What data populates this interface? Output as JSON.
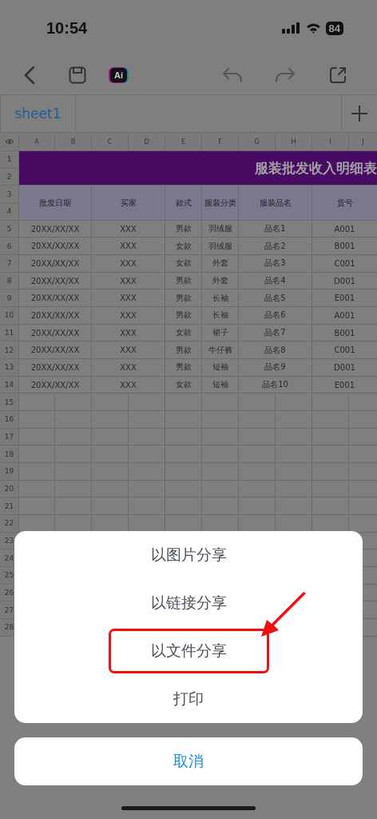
{
  "status_bar": {
    "time": "10:54",
    "battery": "84"
  },
  "toolbar": {
    "ai_label": "Ai"
  },
  "sheet_tabs": [
    {
      "label": "sheet1",
      "selected": true
    }
  ],
  "spreadsheet": {
    "column_headers": [
      "A",
      "B",
      "C",
      "D",
      "E",
      "F",
      "G",
      "H",
      "I",
      "J"
    ],
    "title_rows": [
      "1",
      "2"
    ],
    "title": "服装批发收入明细表",
    "header_rows": [
      "3",
      "4"
    ],
    "columns": [
      {
        "label": "批发日期"
      },
      {
        "label": "买家"
      },
      {
        "label": "款式"
      },
      {
        "label": "服装分类"
      },
      {
        "label": "服装品名"
      },
      {
        "label": "货号"
      }
    ],
    "rows": [
      {
        "number": "5",
        "cells": [
          "20XX/XX/XX",
          "XXX",
          "男款",
          "羽绒服",
          "品名1",
          "A001"
        ]
      },
      {
        "number": "6",
        "cells": [
          "20XX/XX/XX",
          "XXX",
          "女款",
          "羽绒服",
          "品名2",
          "B001"
        ]
      },
      {
        "number": "7",
        "cells": [
          "20XX/XX/XX",
          "XXX",
          "女款",
          "外套",
          "品名3",
          "C001"
        ]
      },
      {
        "number": "8",
        "cells": [
          "20XX/XX/XX",
          "XXX",
          "男款",
          "外套",
          "品名4",
          "D001"
        ]
      },
      {
        "number": "9",
        "cells": [
          "20XX/XX/XX",
          "XXX",
          "男款",
          "长袖",
          "品名5",
          "E001"
        ]
      },
      {
        "number": "10",
        "cells": [
          "20XX/XX/XX",
          "XXX",
          "男款",
          "长袖",
          "品名6",
          "A001"
        ]
      },
      {
        "number": "11",
        "cells": [
          "20XX/XX/XX",
          "XXX",
          "女款",
          "裙子",
          "品名7",
          "B001"
        ]
      },
      {
        "number": "12",
        "cells": [
          "20XX/XX/XX",
          "XXX",
          "男款",
          "牛仔裤",
          "品名8",
          "C001"
        ]
      },
      {
        "number": "13",
        "cells": [
          "20XX/XX/XX",
          "XXX",
          "男款",
          "短袖",
          "品名9",
          "D001"
        ]
      },
      {
        "number": "14",
        "cells": [
          "20XX/XX/XX",
          "XXX",
          "女款",
          "短袖",
          "品名10",
          "E001"
        ]
      }
    ],
    "empty_rows": [
      "15",
      "16",
      "17",
      "18",
      "19",
      "20",
      "21",
      "22",
      "23",
      "24",
      "25",
      "26",
      "27",
      "28"
    ]
  },
  "action_sheet": {
    "items": [
      {
        "label": "以图片分享",
        "highlighted": false
      },
      {
        "label": "以链接分享",
        "highlighted": false
      },
      {
        "label": "以文件分享",
        "highlighted": true
      },
      {
        "label": "打印",
        "highlighted": false
      }
    ],
    "cancel": "取消"
  }
}
